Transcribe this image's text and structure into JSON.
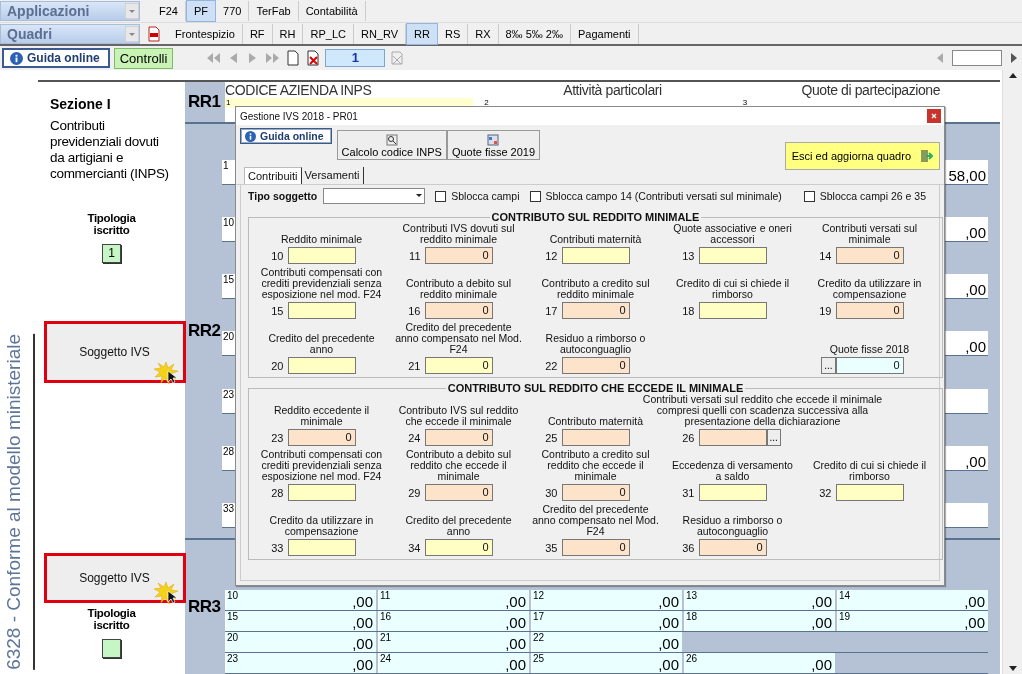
{
  "menu_row1": {
    "dropdown": "Applicazioni",
    "tabs": [
      {
        "label": "F24",
        "selected": false
      },
      {
        "label": "PF",
        "selected": true
      },
      {
        "label": "770",
        "selected": false
      },
      {
        "label": "TerFab",
        "selected": false
      },
      {
        "label": "Contabilità",
        "selected": false
      }
    ]
  },
  "menu_row2": {
    "dropdown": "Quadri",
    "tabs": [
      {
        "label": "Frontespizio",
        "selected": false
      },
      {
        "label": "RF",
        "selected": false
      },
      {
        "label": "RH",
        "selected": false
      },
      {
        "label": "RP_LC",
        "selected": false
      },
      {
        "label": "RN_RV",
        "selected": false
      },
      {
        "label": "RR",
        "selected": true
      },
      {
        "label": "RS",
        "selected": false
      },
      {
        "label": "RX",
        "selected": false
      },
      {
        "label": "8‰ 5‰ 2‰",
        "selected": false
      },
      {
        "label": "Pagamenti",
        "selected": false
      }
    ]
  },
  "nav": {
    "guide_button": "Guida online",
    "check_button": "Controlli",
    "page": "1"
  },
  "side_label": "6328 - Conforme al modello ministeriale",
  "section": {
    "title": "Sezione I",
    "description": "Contributi previdenziali dovuti da artigiani e commercianti (INPS)",
    "tipologia_1": {
      "label": "Tipologia iscritto",
      "value": "1"
    },
    "ivs_buttons": [
      "Soggetto IVS",
      "Soggetto IVS"
    ],
    "tipologia_2": {
      "label": "Tipologia iscritto"
    }
  },
  "form": {
    "rr1": {
      "code": "RR1",
      "headers": [
        "CODICE AZIENDA INPS",
        "Attività particolari",
        "Quote di partecipazione"
      ],
      "fields": [
        {
          "num": "1",
          "kind": "input"
        },
        {
          "num": "2",
          "kind": "plain"
        },
        {
          "num": "3",
          "kind": "plain"
        }
      ]
    },
    "rr2": {
      "code": "RR2",
      "rows": [
        {
          "num": "1",
          "value": "58,00"
        },
        {
          "num": "10",
          "value": ",00"
        },
        {
          "num": "15",
          "value": ",00"
        },
        {
          "num": "20",
          "value": ",00"
        },
        {
          "num": "23"
        },
        {
          "num": "28",
          "value": ",00"
        },
        {
          "num": "33"
        }
      ]
    },
    "rr3": {
      "code": "RR3",
      "rows": [
        [
          {
            "num": "10",
            "value": ",00"
          },
          {
            "num": "11",
            "value": ",00"
          },
          {
            "num": "12",
            "value": ",00"
          },
          {
            "num": "13",
            "value": ",00"
          },
          {
            "num": "14",
            "value": ",00"
          }
        ],
        [
          {
            "num": "15",
            "value": ",00"
          },
          {
            "num": "16",
            "value": ",00"
          },
          {
            "num": "17",
            "value": ",00"
          },
          {
            "num": "18",
            "value": ",00"
          },
          {
            "num": "19",
            "value": ",00"
          }
        ],
        [
          {
            "num": "20",
            "value": ",00"
          },
          {
            "num": "21",
            "value": ",00"
          },
          {
            "num": "22",
            "value": ",00"
          }
        ],
        [
          {
            "num": "23",
            "value": ",00"
          },
          {
            "num": "24",
            "value": ",00"
          },
          {
            "num": "25",
            "value": ",00"
          },
          {
            "num": "26",
            "value": ",00"
          }
        ]
      ]
    }
  },
  "dialog": {
    "title": "Gestione IVS 2018 - PR01",
    "toolbar": {
      "guide": "Guida online",
      "buttons": [
        "Calcolo codice INPS",
        "Quote fisse 2019"
      ],
      "exit": "Esci ed aggiorna quadro"
    },
    "tabs": [
      {
        "label": "Contribuiti",
        "selected": true
      },
      {
        "label": "Versamenti",
        "selected": false
      }
    ],
    "filter": {
      "label": "Tipo soggetto"
    },
    "checkboxes": [
      {
        "label": "Sblocca campi",
        "checked": false
      },
      {
        "label": "Sblocca campo 14 (Contributi versati sul minimale)",
        "checked": false
      },
      {
        "label": "Sblocca campi 26 e 35",
        "checked": false
      }
    ],
    "sections": [
      {
        "title": "CONTRIBUTO SUL REDDITO MINIMALE",
        "rows": [
          [
            {
              "num": "10",
              "label": "Reddito minimale",
              "kind": "input"
            },
            {
              "num": "11",
              "label": "Contributi IVS dovuti sul reddito minimale",
              "kind": "calc",
              "value": "0"
            },
            {
              "num": "12",
              "label": "Contributi maternità",
              "kind": "input"
            },
            {
              "num": "13",
              "label": "Quote associative e oneri accessori",
              "kind": "input"
            },
            {
              "num": "14",
              "label": "Contributi versati sul minimale",
              "kind": "calc",
              "value": "0"
            }
          ],
          [
            {
              "num": "15",
              "label": "Contributi compensati con crediti previdenziali senza esposizione nel mod. F24",
              "kind": "input"
            },
            {
              "num": "16",
              "label": "Contributo a debito sul reddito minimale",
              "kind": "calc",
              "value": "0"
            },
            {
              "num": "17",
              "label": "Contributo a credito sul reddito minimale",
              "kind": "calc",
              "value": "0"
            },
            {
              "num": "18",
              "label": "Credito di cui si chiede il rimborso",
              "kind": "input"
            },
            {
              "num": "19",
              "label": "Credito da utilizzare in compensazione",
              "kind": "calc",
              "value": "0"
            }
          ],
          [
            {
              "num": "20",
              "label": "Credito del precedente anno",
              "kind": "input"
            },
            {
              "num": "21",
              "label": "Credito del precedente anno compensato nel Mod. F24",
              "kind": "input",
              "value": "0"
            },
            {
              "num": "22",
              "label": "Residuo a rimborso o autoconguaglio",
              "kind": "calc",
              "value": "0"
            },
            "",
            {
              "label": "Quote fisse 2018",
              "kind": "fixed",
              "button": "...",
              "value": "0"
            }
          ]
        ]
      },
      {
        "title": "CONTRIBUTO SUL REDDITO CHE ECCEDE IL MINIMALE",
        "rows": [
          [
            {
              "num": "23",
              "label": "Reddito eccedente il minimale",
              "kind": "calc",
              "value": "0"
            },
            {
              "num": "24",
              "label": "Contributo IVS sul reddito che eccede il minimale",
              "kind": "calc",
              "value": "0"
            },
            {
              "num": "25",
              "label": "Contributo maternità",
              "kind": "calc"
            },
            {
              "num": "26",
              "label": "Contributi versati sul reddito che eccede il minimale compresi quelli con scadenza successiva alla presentazione della dichiarazione",
              "kind": "calc_more",
              "button": "..."
            }
          ],
          [
            {
              "num": "28",
              "label": "Contributi compensati con crediti previdenziali senza esposizione nel mod. F24",
              "kind": "input"
            },
            {
              "num": "29",
              "label": "Contributo a debito sul reddito che eccede il minimale",
              "kind": "calc",
              "value": "0"
            },
            {
              "num": "30",
              "label": "Contributo a credito sul reddito che eccede il minimale",
              "kind": "calc",
              "value": "0"
            },
            {
              "num": "31",
              "label": "Eccedenza di versamento a saldo",
              "kind": "input"
            },
            {
              "num": "32",
              "label": "Credito di cui si chiede il rimborso",
              "kind": "input"
            }
          ],
          [
            {
              "num": "33",
              "label": "Credito da utilizzare in compensazione",
              "kind": "input"
            },
            {
              "num": "34",
              "label": "Credito del precedente anno",
              "kind": "input",
              "value": "0"
            },
            {
              "num": "35",
              "label": "Credito del precedente anno compensato nel Mod. F24",
              "kind": "calc",
              "value": "0"
            },
            {
              "num": "36",
              "label": "Residuo a rimborso o autoconguaglio",
              "kind": "calc",
              "value": "0"
            }
          ]
        ]
      }
    ]
  }
}
